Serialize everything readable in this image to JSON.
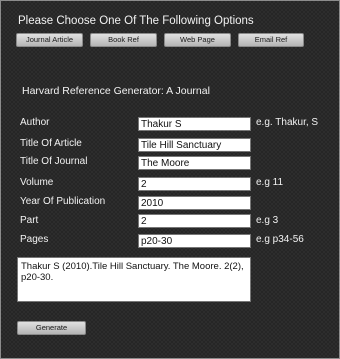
{
  "prompt": "Please Choose One Of The Following Options",
  "tabs": [
    {
      "label": "Journal Article"
    },
    {
      "label": "Book Ref"
    },
    {
      "label": "Web Page"
    },
    {
      "label": "Email Ref"
    }
  ],
  "heading": "Harvard Reference Generator: A Journal",
  "fields": [
    {
      "label": "Author",
      "value": "Thakur S",
      "hint": "e.g. Thakur, S"
    },
    {
      "label": "Title Of Article",
      "value": "Tile Hill Sanctuary",
      "hint": ""
    },
    {
      "label": "Title Of Journal",
      "value": "The Moore",
      "hint": ""
    },
    {
      "label": "Volume",
      "value": "2",
      "hint": "e.g 11"
    },
    {
      "label": "Year Of Publication",
      "value": "2010",
      "hint": ""
    },
    {
      "label": "Part",
      "value": "2",
      "hint": "e.g 3"
    },
    {
      "label": "Pages",
      "value": "p20-30",
      "hint": "e.g p34-56"
    }
  ],
  "result": "Thakur S (2010).Tile Hill Sanctuary. The Moore. 2(2), p20-30.",
  "generate_label": "Generate"
}
